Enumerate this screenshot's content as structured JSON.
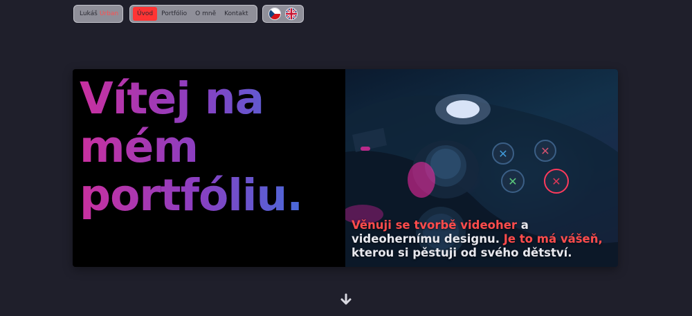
{
  "nav": {
    "brand_first": "Lukáš",
    "brand_last": "Urban",
    "items": [
      {
        "label": "Úvod",
        "active": true
      },
      {
        "label": "Portfólio",
        "active": false
      },
      {
        "label": "O mně",
        "active": false
      },
      {
        "label": "Kontakt",
        "active": false
      }
    ],
    "languages": [
      {
        "code": "cs",
        "icon": "czech-flag-icon"
      },
      {
        "code": "en",
        "icon": "uk-flag-icon"
      }
    ]
  },
  "hero": {
    "title_line1": "Vítej na",
    "title_line2": "mém",
    "title_line3": "portfóliu.",
    "text_part1": "Věnuji se tvorbě videoher",
    "text_part2": " a videohernímu designu. ",
    "text_part3": "Je to má vášeň,",
    "text_part4": " kterou si pěstuji od svého dětství.",
    "accent_color": "#ff4c4c"
  },
  "scroll": {
    "icon": "arrow-down-icon"
  }
}
